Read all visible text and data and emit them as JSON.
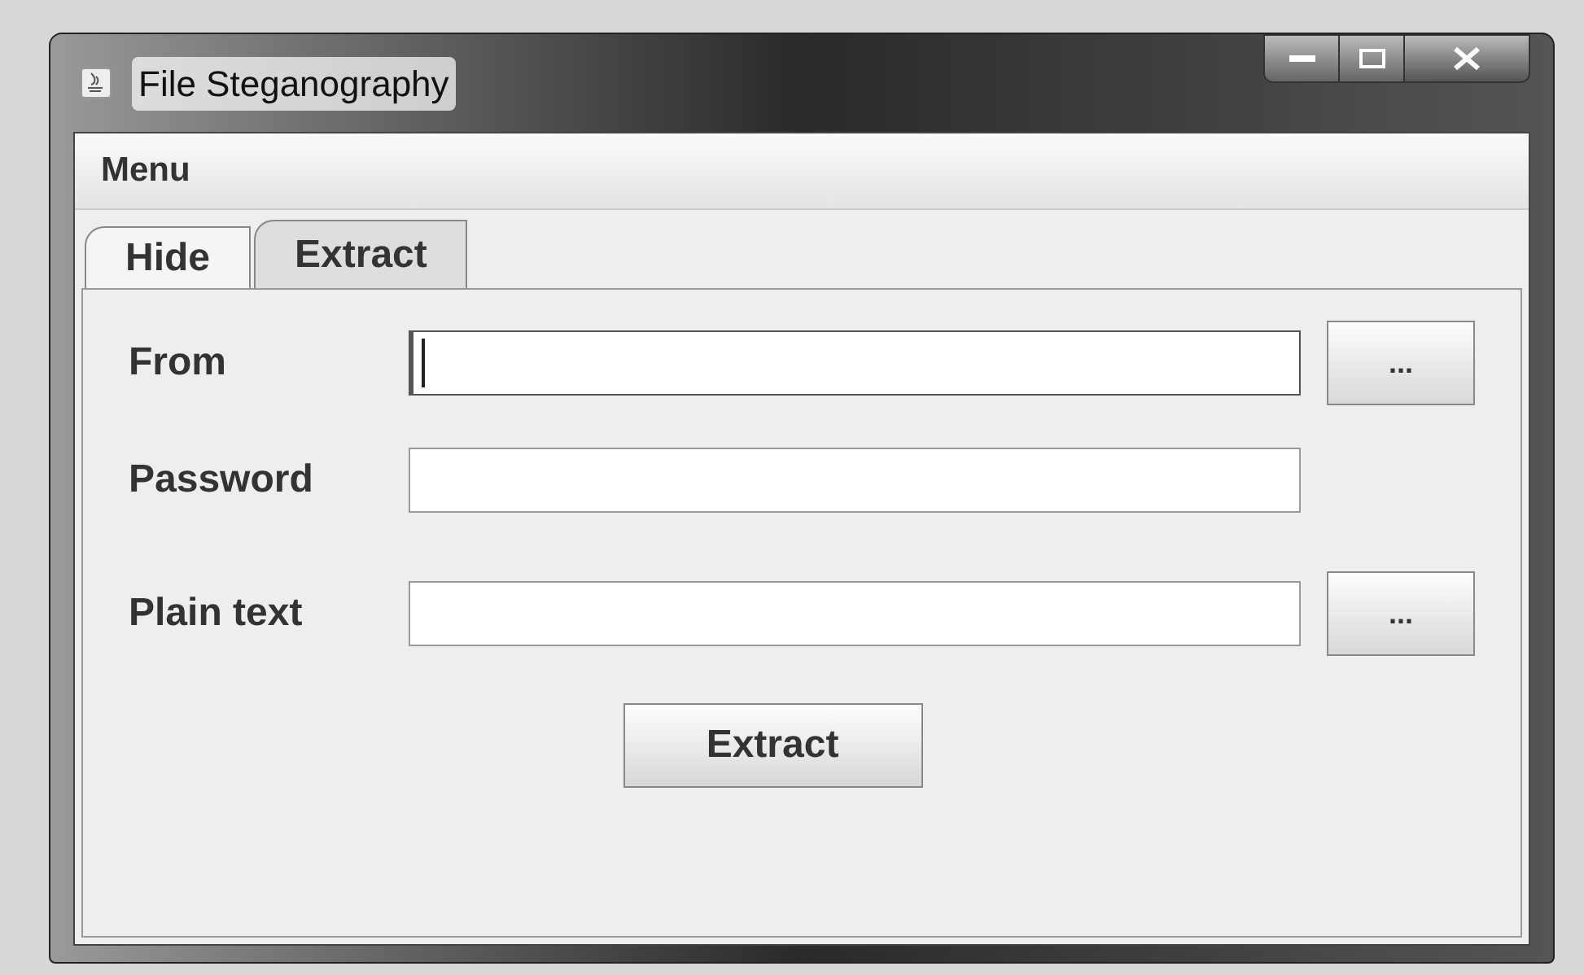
{
  "window": {
    "title": "File Steganography"
  },
  "menu_bar": {
    "items": [
      "Menu"
    ]
  },
  "tabs": [
    {
      "label": "Hide",
      "selected": false
    },
    {
      "label": "Extract",
      "selected": true
    }
  ],
  "form": {
    "rows": [
      {
        "label": "From",
        "focused": true,
        "browse_button": "..."
      },
      {
        "label": "Password",
        "focused": false
      },
      {
        "label": "Plain text",
        "focused": false,
        "browse_button": "..."
      }
    ],
    "action_button": "Extract"
  }
}
